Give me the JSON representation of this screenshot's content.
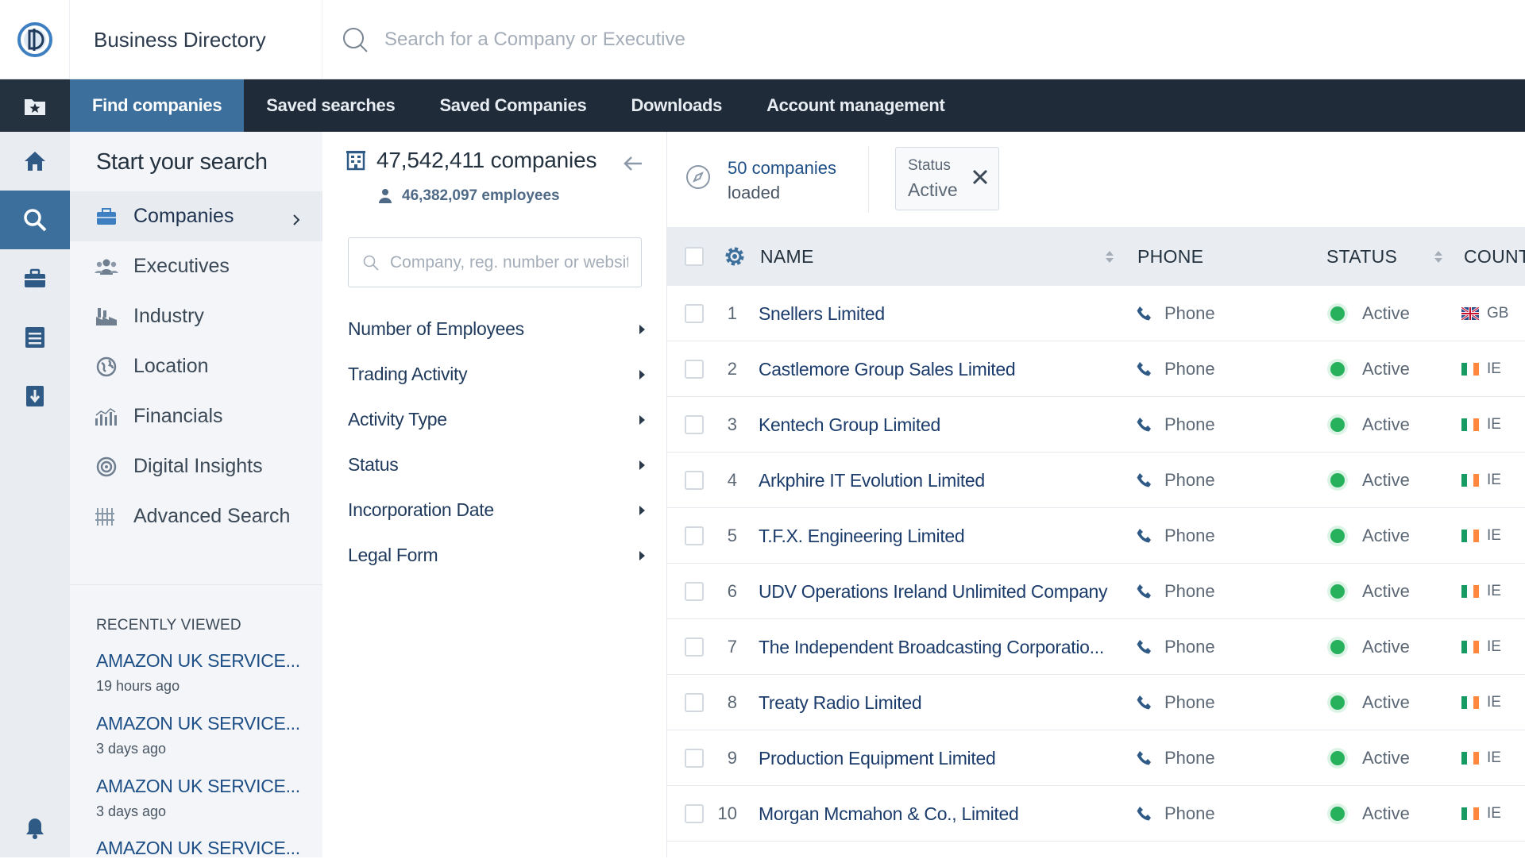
{
  "header": {
    "brand": "Business Directory",
    "search_placeholder": "Search for a Company or Executive"
  },
  "nav": {
    "items": [
      {
        "label": "Find companies",
        "active": true
      },
      {
        "label": "Saved searches",
        "active": false
      },
      {
        "label": "Saved Companies",
        "active": false
      },
      {
        "label": "Downloads",
        "active": false
      },
      {
        "label": "Account management",
        "active": false
      }
    ]
  },
  "rail": {
    "icons": [
      "star-folder-icon",
      "home-icon",
      "search-icon",
      "briefcase-icon",
      "list-icon",
      "download-icon",
      "bell-icon"
    ],
    "active": "search-icon"
  },
  "categories": {
    "title": "Start your search",
    "items": [
      {
        "label": "Companies",
        "icon": "building-icon",
        "active": true
      },
      {
        "label": "Executives",
        "icon": "people-icon",
        "active": false
      },
      {
        "label": "Industry",
        "icon": "factory-icon",
        "active": false
      },
      {
        "label": "Location",
        "icon": "globe-icon",
        "active": false
      },
      {
        "label": "Financials",
        "icon": "chart-icon",
        "active": false
      },
      {
        "label": "Digital Insights",
        "icon": "target-icon",
        "active": false
      },
      {
        "label": "Advanced Search",
        "icon": "bars-icon",
        "active": false
      }
    ]
  },
  "recent": {
    "title": "RECENTLY VIEWED",
    "items": [
      {
        "name": "AMAZON UK SERVICE...",
        "time": "19 hours ago"
      },
      {
        "name": "AMAZON UK SERVICE...",
        "time": "3 days ago"
      },
      {
        "name": "AMAZON UK SERVICE...",
        "time": "3 days ago"
      },
      {
        "name": "AMAZON UK SERVICE...",
        "time": ""
      }
    ]
  },
  "filters": {
    "company_count": "47,542,411 companies",
    "employee_count": "46,382,097 employees",
    "input_placeholder": "Company, reg. number or website",
    "items": [
      "Number of Employees",
      "Trading Activity",
      "Activity Type",
      "Status",
      "Incorporation Date",
      "Legal Form"
    ]
  },
  "results": {
    "loaded_count": "50 companies",
    "loaded_label": "loaded",
    "chip": {
      "label": "Status",
      "value": "Active"
    },
    "columns": {
      "name": "NAME",
      "phone": "PHONE",
      "status": "STATUS",
      "country": "COUNT"
    },
    "rows": [
      {
        "num": "1",
        "name": "Snellers Limited",
        "phone": "Phone",
        "status": "Active",
        "country": "GB"
      },
      {
        "num": "2",
        "name": "Castlemore Group Sales Limited",
        "phone": "Phone",
        "status": "Active",
        "country": "IE"
      },
      {
        "num": "3",
        "name": "Kentech Group Limited",
        "phone": "Phone",
        "status": "Active",
        "country": "IE"
      },
      {
        "num": "4",
        "name": "Arkphire IT Evolution Limited",
        "phone": "Phone",
        "status": "Active",
        "country": "IE"
      },
      {
        "num": "5",
        "name": "T.F.X. Engineering Limited",
        "phone": "Phone",
        "status": "Active",
        "country": "IE"
      },
      {
        "num": "6",
        "name": "UDV Operations Ireland Unlimited Company",
        "phone": "Phone",
        "status": "Active",
        "country": "IE"
      },
      {
        "num": "7",
        "name": "The Independent Broadcasting Corporatio...",
        "phone": "Phone",
        "status": "Active",
        "country": "IE"
      },
      {
        "num": "8",
        "name": "Treaty Radio Limited",
        "phone": "Phone",
        "status": "Active",
        "country": "IE"
      },
      {
        "num": "9",
        "name": "Production Equipment Limited",
        "phone": "Phone",
        "status": "Active",
        "country": "IE"
      },
      {
        "num": "10",
        "name": "Morgan Mcmahon & Co., Limited",
        "phone": "Phone",
        "status": "Active",
        "country": "IE"
      }
    ]
  },
  "colors": {
    "navbar": "#1f2b38",
    "accent": "#3d6f9c",
    "link": "#1d4f86",
    "status_active": "#27b15c"
  }
}
